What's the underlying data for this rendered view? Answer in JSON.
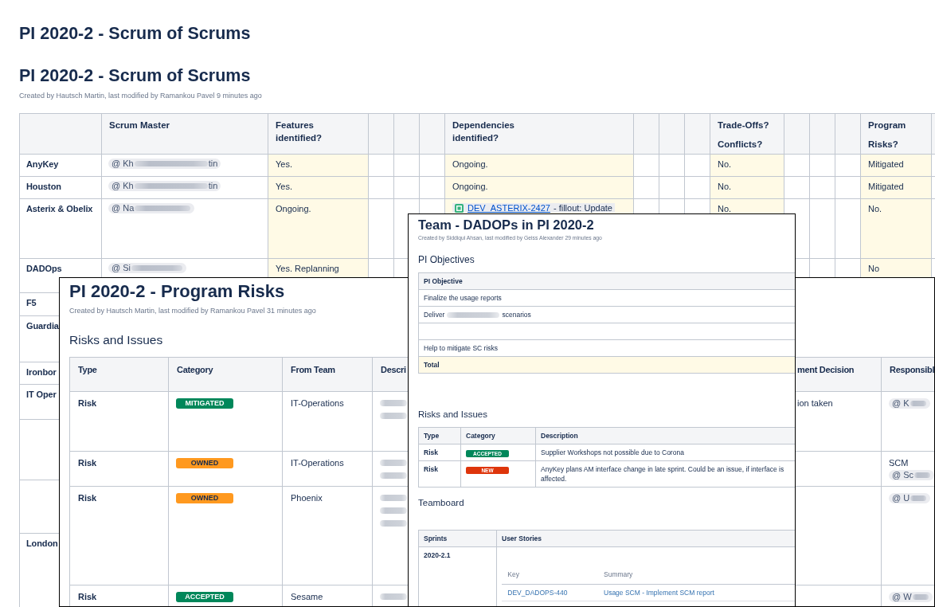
{
  "scrum_page": {
    "header_title": "PI 2020-2 - Scrum of Scrums",
    "title": "PI 2020-2 - Scrum of Scrums",
    "byline": "Created by Hautsch Martin, last modified by Ramankou Pavel 9 minutes ago",
    "table": {
      "columns": [
        {
          "kind": "team"
        },
        {
          "kind": "person",
          "label": [
            "Scrum Master"
          ]
        },
        {
          "kind": "answer",
          "label": [
            "Features\nidentified?"
          ]
        },
        {
          "kind": "spacer"
        },
        {
          "kind": "spacer"
        },
        {
          "kind": "spacer"
        },
        {
          "kind": "answer",
          "label": [
            "Dependencies\nidentified?"
          ]
        },
        {
          "kind": "spacer"
        },
        {
          "kind": "spacer"
        },
        {
          "kind": "spacer"
        },
        {
          "kind": "answer",
          "label": [
            "Trade-Offs?",
            "Conflicts?"
          ]
        },
        {
          "kind": "spacer"
        },
        {
          "kind": "spacer"
        },
        {
          "kind": "spacer"
        },
        {
          "kind": "answer",
          "label": [
            "Program",
            "Risks?"
          ]
        },
        {
          "kind": "spacer"
        }
      ],
      "rows": [
        {
          "team": "AnyKey",
          "scrum_master": {
            "start": "@ Kh",
            "end": "tin"
          },
          "features": "Yes.",
          "dependencies": {
            "kind": "text",
            "text": "Ongoing."
          },
          "trade_offs": "No.",
          "program_risks": "Mitigated"
        },
        {
          "team": "Houston",
          "scrum_master": {
            "start": "@ Kh",
            "end": "tin"
          },
          "features": "Yes.",
          "dependencies": {
            "kind": "text",
            "text": "Ongoing."
          },
          "trade_offs": "No.",
          "program_risks": "Mitigated"
        },
        {
          "team": "Asterix & Obelix",
          "scrum_master": {
            "start": "@ Na"
          },
          "features": "Ongoing.",
          "dependencies": {
            "kind": "issue",
            "key": "DEV_ASTERIX-2427",
            "summary": "- fillout: Update"
          },
          "trade_offs": "No.",
          "program_risks": "No."
        },
        {
          "team": "DADOps",
          "scrum_master": {
            "start": "@ Si"
          },
          "features": "Yes. Replanning",
          "program_risks": "No"
        },
        {
          "team": "F5"
        },
        {
          "team": "Guardia"
        },
        {
          "team": "Ironbor"
        },
        {
          "team": "IT Oper"
        },
        {},
        {},
        {
          "team": "London"
        }
      ]
    }
  },
  "risks_window": {
    "title": "PI 2020-2 - Program Risks",
    "byline": "Created by Hautsch Martin, last modified by Ramankou Pavel 31 minutes ago",
    "heading": "Risks and Issues",
    "columns": [
      "Type",
      "Category",
      "From Team",
      "Descri",
      "ment Decision",
      "Responsibl"
    ],
    "rows": [
      {
        "type": "Risk",
        "category": {
          "label": "MITIGATED",
          "color": "#00875a"
        },
        "team": "IT-Operations",
        "decision": "ion taken",
        "responsible": [
          {
            "kind": "mention",
            "start": "@ K"
          }
        ]
      },
      {
        "type": "Risk",
        "category": {
          "label": "OWNED",
          "color": "#ff991f"
        },
        "team": "IT-Operations",
        "responsible": [
          {
            "kind": "text",
            "text": "SCM"
          },
          {
            "kind": "mention",
            "start": "@ Sc"
          }
        ]
      },
      {
        "type": "Risk",
        "category": {
          "label": "OWNED",
          "color": "#ff991f"
        },
        "team": "Phoenix",
        "responsible": [
          {
            "kind": "mention",
            "start": "@ U"
          }
        ]
      },
      {
        "type": "Risk",
        "category": {
          "label": "ACCEPTED",
          "color": "#00875a"
        },
        "team": "Sesame",
        "responsible": [
          {
            "kind": "mention",
            "start": "@ W"
          }
        ]
      }
    ]
  },
  "team_window": {
    "title": "Team - DADOPs in PI 2020-2",
    "byline": "Created by Siddiqui Ahsan, last modified by Geiss Alexander 29 minutes ago",
    "objectives": {
      "heading": "PI Objectives",
      "column": "PI Objective",
      "rows": [
        {
          "kind": "objective",
          "text": "Finalize the usage reports"
        },
        {
          "kind": "redacted",
          "before": "Deliver",
          "after": "scenarios"
        },
        {
          "kind": "blank"
        },
        {
          "kind": "objective",
          "text": "Help to mitigate SC risks"
        },
        {
          "kind": "total",
          "text": "Total"
        }
      ]
    },
    "risks": {
      "heading": "Risks and Issues",
      "columns": [
        "Type",
        "Category",
        "Description"
      ],
      "rows": [
        {
          "type": "Risk",
          "category": {
            "label": "ACCEPTED",
            "color": "#00875a"
          },
          "description": "Supplier Workshops not possible due to Corona"
        },
        {
          "type": "Risk",
          "category": {
            "label": "NEW",
            "color": "#de350b"
          },
          "description": "AnyKey plans AM interface change in late sprint. Could be an issue, if interface is affected."
        }
      ]
    },
    "teamboard": {
      "heading": "Teamboard",
      "columns": [
        "Sprints",
        "User Stories"
      ],
      "rows": [
        {
          "sprint": "2020-2.1",
          "stories": {
            "columns": [
              "Key",
              "Summary"
            ],
            "rows": [
              {
                "key": "DEV_DADOPS-440",
                "summary": "Usage SCM - Implement SCM report"
              }
            ]
          }
        }
      ]
    }
  }
}
